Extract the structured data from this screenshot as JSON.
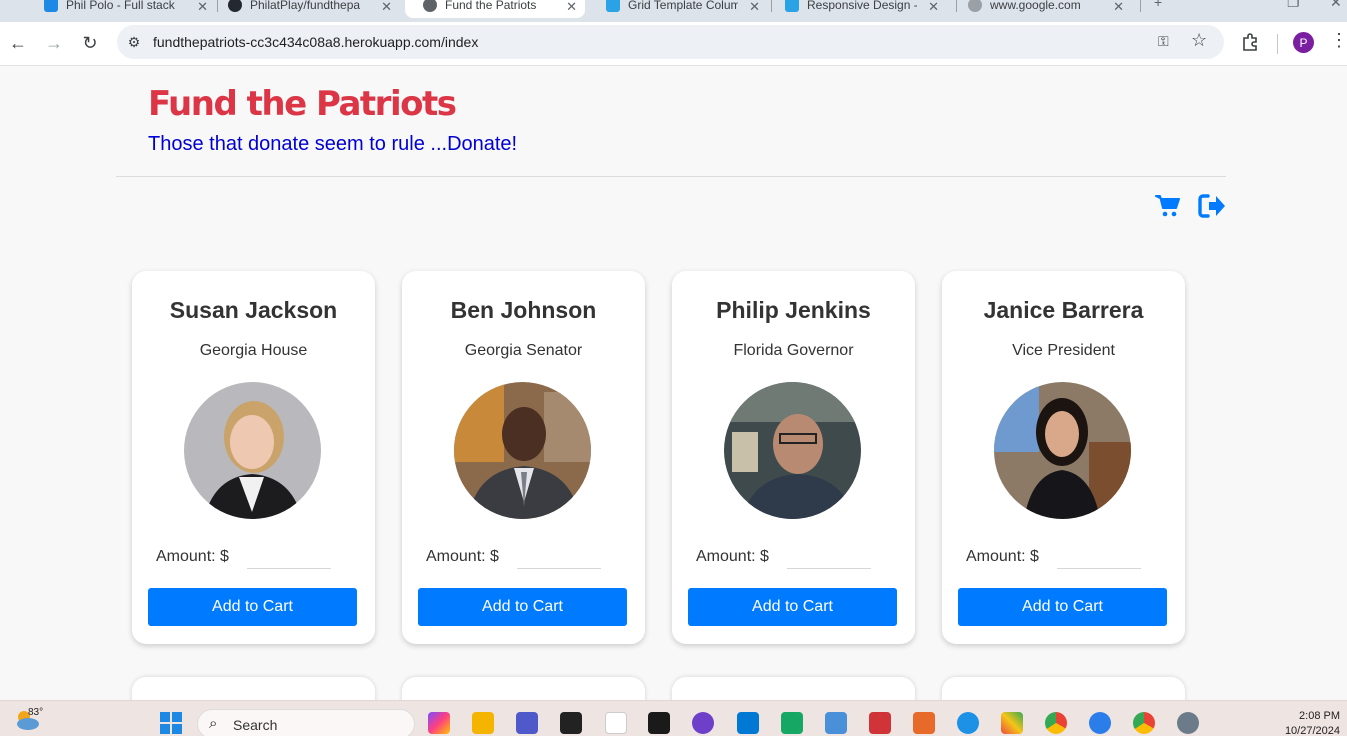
{
  "browser": {
    "tabs": [
      {
        "title": "Phil Polo - Full stack",
        "color": "#1e88e5"
      },
      {
        "title": "PhilatPlay/fundthepat",
        "color": "#24292f"
      },
      {
        "title": "Fund the Patriots",
        "color": "#5f6368"
      },
      {
        "title": "Grid Template Colum",
        "color": "#29a3e6"
      },
      {
        "title": "Responsive Design -",
        "color": "#29a3e6"
      },
      {
        "title": "www.google.com",
        "color": "#9aa0a6"
      }
    ],
    "url": "fundthepatriots-cc3c434c08a8.herokuapp.com/index",
    "profile_initial": "P"
  },
  "page": {
    "title": "Fund the Patriots",
    "tagline": "Those that donate seem to rule ...Donate!",
    "accent": "#007bff",
    "title_color": "#dc3545"
  },
  "candidates": [
    {
      "name": "Susan Jackson",
      "role": "Georgia House",
      "amount_label": "Amount: $",
      "amount_value": "",
      "button": "Add to Cart"
    },
    {
      "name": "Ben Johnson",
      "role": "Georgia Senator",
      "amount_label": "Amount: $",
      "amount_value": "",
      "button": "Add to Cart"
    },
    {
      "name": "Philip Jenkins",
      "role": "Florida Governor",
      "amount_label": "Amount: $",
      "amount_value": "",
      "button": "Add to Cart"
    },
    {
      "name": "Janice Barrera",
      "role": "Vice President",
      "amount_label": "Amount: $",
      "amount_value": "",
      "button": "Add to Cart"
    }
  ],
  "taskbar": {
    "temperature": "83°",
    "search_label": "Search",
    "time": "2:08 PM",
    "date": "10/27/2024",
    "apps": [
      "file-explorer",
      "teams",
      "terminal",
      "mongodb",
      "intellij",
      "github-desktop",
      "vscode",
      "sheets",
      "notepad",
      "settings-app",
      "snipping-tool",
      "docker",
      "git",
      "chrome",
      "app-blue",
      "chrome-2",
      "gear"
    ]
  }
}
